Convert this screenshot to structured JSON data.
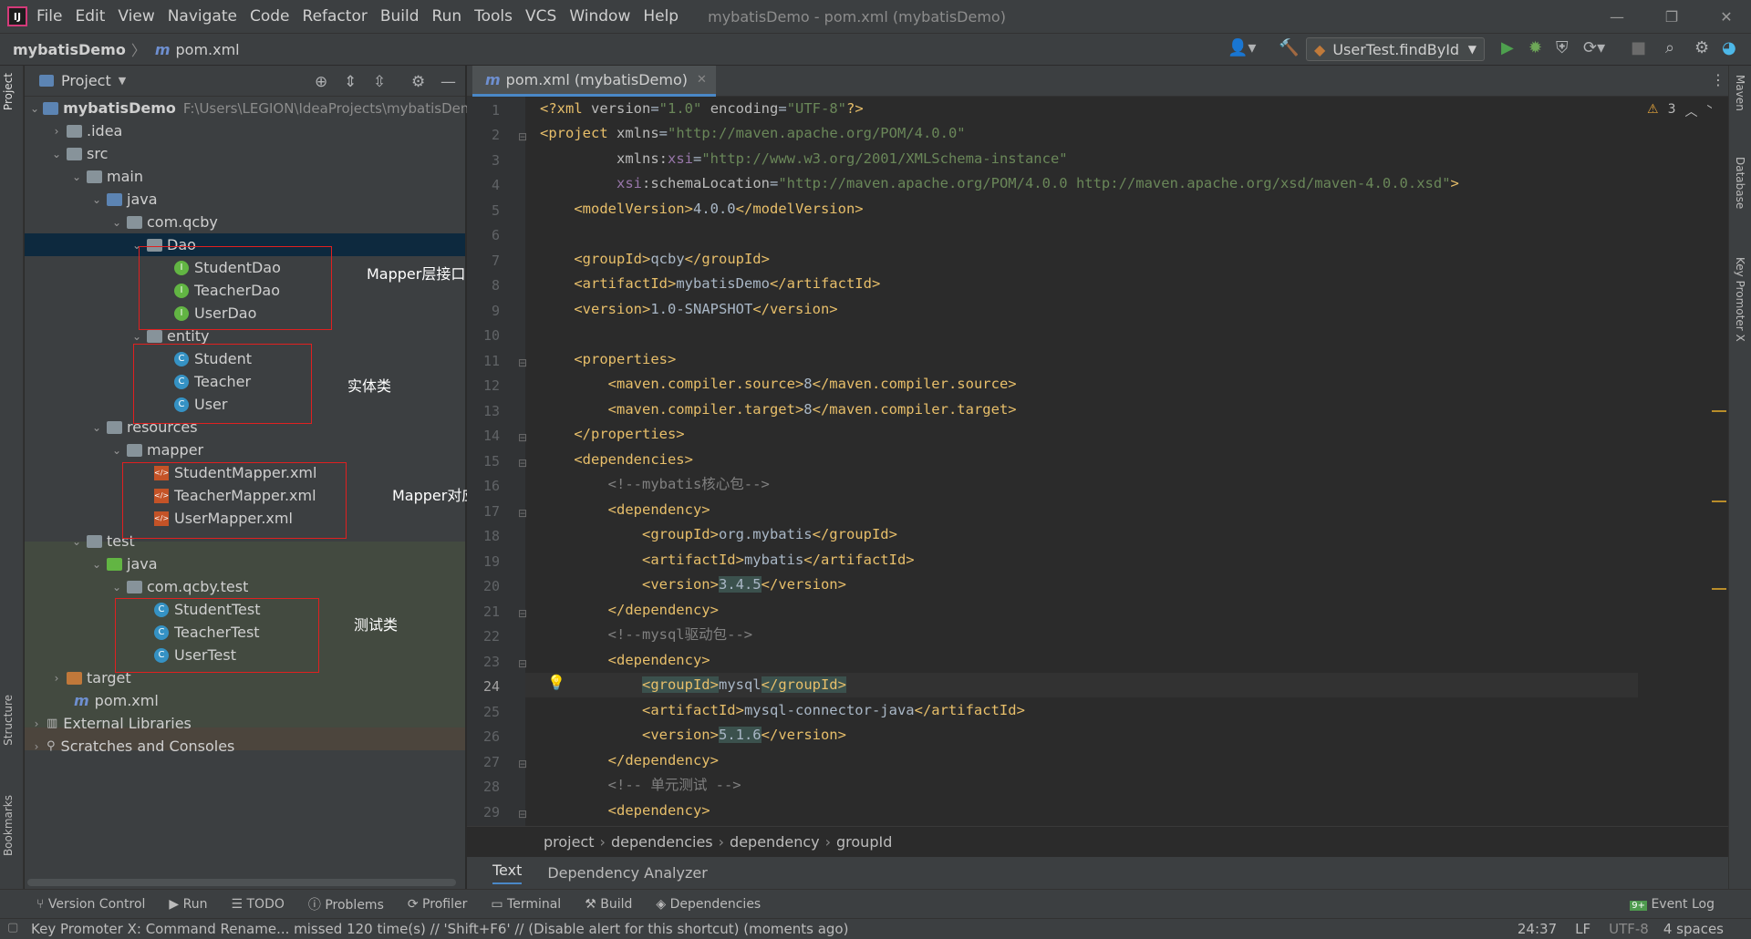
{
  "titlebar": {
    "menu": [
      "File",
      "Edit",
      "View",
      "Navigate",
      "Code",
      "Refactor",
      "Build",
      "Run",
      "Tools",
      "VCS",
      "Window",
      "Help"
    ],
    "title": "mybatisDemo - pom.xml (mybatisDemo)"
  },
  "navbar": {
    "project": "mybatisDemo",
    "file": "pom.xml",
    "run_config": "UserTest.findById"
  },
  "left_tabs": {
    "project": "Project",
    "structure": "Structure",
    "bookmarks": "Bookmarks"
  },
  "right_tabs": {
    "maven": "Maven",
    "database": "Database",
    "key_promoter": "Key Promoter X"
  },
  "project_panel": {
    "title": "Project",
    "tree": [
      {
        "label": "mybatisDemo",
        "hint": "F:\\Users\\LEGION\\IdeaProjects\\mybatisDem"
      },
      {
        "label": ".idea"
      },
      {
        "label": "src"
      },
      {
        "label": "main"
      },
      {
        "label": "java"
      },
      {
        "label": "com.qcby"
      },
      {
        "label": "Dao"
      },
      {
        "label": "StudentDao"
      },
      {
        "label": "TeacherDao"
      },
      {
        "label": "UserDao"
      },
      {
        "label": "entity"
      },
      {
        "label": "Student"
      },
      {
        "label": "Teacher"
      },
      {
        "label": "User"
      },
      {
        "label": "resources"
      },
      {
        "label": "mapper"
      },
      {
        "label": "StudentMapper.xml"
      },
      {
        "label": "TeacherMapper.xml"
      },
      {
        "label": "UserMapper.xml"
      },
      {
        "label": "test"
      },
      {
        "label": "java"
      },
      {
        "label": "com.qcby.test"
      },
      {
        "label": "StudentTest"
      },
      {
        "label": "TeacherTest"
      },
      {
        "label": "UserTest"
      },
      {
        "label": "target"
      },
      {
        "label": "pom.xml"
      },
      {
        "label": "External Libraries"
      },
      {
        "label": "Scratches and Consoles"
      }
    ]
  },
  "annotations": {
    "mapper_interface": "Mapper层接口（之前写的Dao没改）",
    "entity": "实体类",
    "mapper_xml": "Mapper对应的xml文件",
    "test": "测试类"
  },
  "editor": {
    "tab": "pom.xml (mybatisDemo)",
    "warnings": "3",
    "line_numbers": [
      "1",
      "2",
      "3",
      "4",
      "5",
      "6",
      "7",
      "8",
      "9",
      "10",
      "11",
      "12",
      "13",
      "14",
      "15",
      "16",
      "17",
      "18",
      "19",
      "20",
      "21",
      "22",
      "23",
      "24",
      "25",
      "26",
      "27",
      "28",
      "29"
    ],
    "breadcrumb": [
      "project",
      "dependencies",
      "dependency",
      "groupId"
    ],
    "bottom_tabs": [
      "Text",
      "Dependency Analyzer"
    ]
  },
  "bottom_toolbar": [
    "Version Control",
    "Run",
    "TODO",
    "Problems",
    "Profiler",
    "Terminal",
    "Build",
    "Dependencies"
  ],
  "event_log": "Event Log",
  "status": {
    "message": "Key Promoter X: Command Rename... missed 120 time(s) // 'Shift+F6' // (Disable alert for this shortcut) (moments ago)",
    "position": "24:37",
    "line_sep": "LF",
    "encoding": "UTF-8",
    "indent": "4 spaces"
  }
}
